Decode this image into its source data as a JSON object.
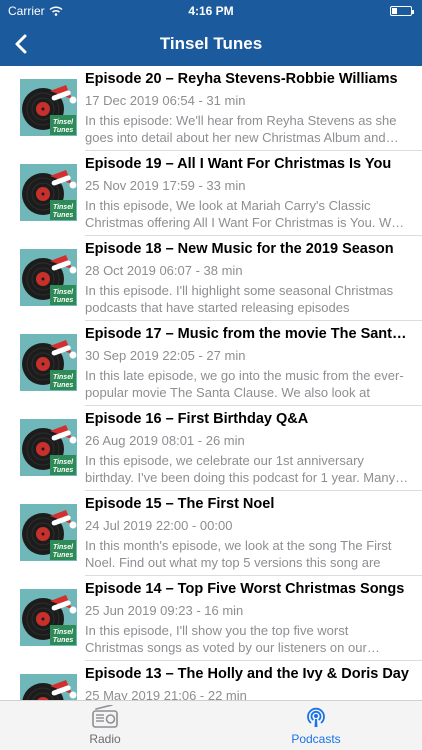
{
  "status_bar": {
    "carrier": "Carrier",
    "time": "4:16 PM"
  },
  "nav": {
    "title": "Tinsel Tunes",
    "back_icon": "chevron-left-icon"
  },
  "colors": {
    "header": "#1b5a9c",
    "accent": "#1a73e8",
    "muted": "#8e8e93"
  },
  "thumbnail": {
    "line1": "Tinsel",
    "line2": "Tunes"
  },
  "episodes": [
    {
      "title": "Episode 20 – Reyha Stevens-Robbie Williams",
      "meta": "17 Dec 2019 06:54 - 31 min",
      "description": "In this episode: We'll hear from Reyha Stevens as she goes into detail about her new Christmas Album and more."
    },
    {
      "title": "Episode 19 – All I Want For Christmas Is You",
      "meta": "25 Nov 2019 17:59 - 33 min",
      "description": "In this episode, We look at Mariah Carry's Classic Christmas offering All I Want For Christmas is You. We look at"
    },
    {
      "title": "Episode 18 – New Music for the 2019 Season",
      "meta": "28 Oct 2019 06:07 - 38 min",
      "description": "In this episode. I'll highlight some seasonal Christmas podcasts that have started releasing episodes"
    },
    {
      "title": "Episode 17 – Music from the movie The Santa Clause",
      "meta": "30 Sep 2019 22:05 - 27 min",
      "description": "In this late episode, we go into the music from the ever-popular movie The Santa Clause. We also look at"
    },
    {
      "title": "Episode 16 – First Birthday Q&A",
      "meta": "26 Aug 2019 08:01 - 26 min",
      "description": "In this episode, we celebrate our 1st anniversary birthday. I've been doing this podcast for 1 year. Many thanks"
    },
    {
      "title": "Episode 15 – The First Noel",
      "meta": "24 Jul 2019 22:00 - 00:00",
      "description": "In this month's episode, we look at the song The First Noel. Find out what my top 5 versions this song are"
    },
    {
      "title": "Episode 14 – Top Five Worst Christmas Songs",
      "meta": "25 Jun 2019 09:23 - 16 min",
      "description": "In this episode, I'll show you the top five worst Christmas songs as voted by our listeners on our website"
    },
    {
      "title": "Episode 13 – The Holly and the Ivy & Doris Day",
      "meta": "25 May 2019 21:06 - 22 min",
      "description": ""
    }
  ],
  "tabs": [
    {
      "label": "Radio",
      "icon": "radio-icon",
      "selected": false
    },
    {
      "label": "Podcasts",
      "icon": "podcast-icon",
      "selected": true
    }
  ]
}
